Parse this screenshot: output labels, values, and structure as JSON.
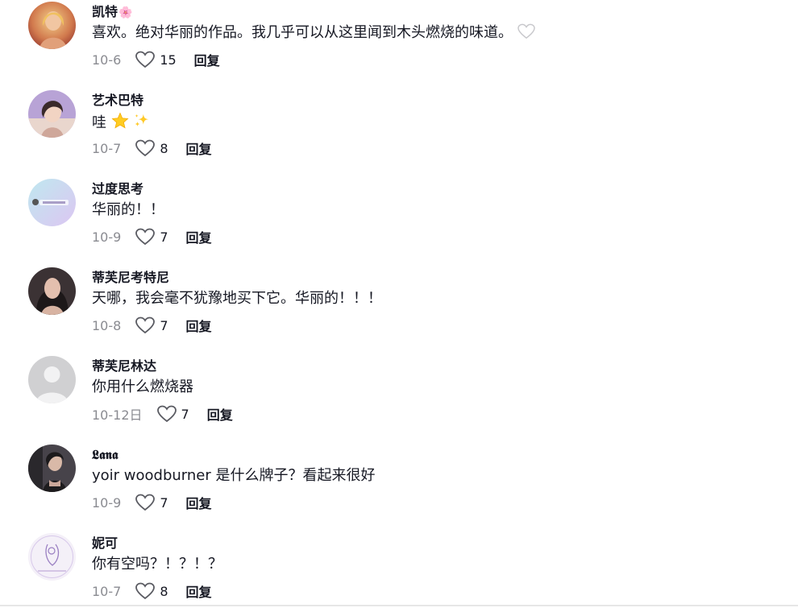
{
  "comments": [
    {
      "username": "凯特",
      "name_emoji": "🌸",
      "text": "喜欢。绝对华丽的作品。我几乎可以从这里闻到木头燃烧的味道。",
      "trailing_icon": "outline-heart-icon",
      "date": "10-6",
      "likes": "15",
      "reply": "回复",
      "avatar_colors": [
        "#c45a48",
        "#e6b15a"
      ]
    },
    {
      "username": "艺术巴特",
      "text": "哇",
      "text_emojis": [
        "star-emoji",
        "sparkles-emoji"
      ],
      "date": "10-7",
      "likes": "8",
      "reply": "回复",
      "avatar_colors": [
        "#8a73b8",
        "#e8d1c5"
      ]
    },
    {
      "username": "过度思考",
      "text": "华丽的！！",
      "date": "10-9",
      "likes": "7",
      "reply": "回复",
      "avatar_colors": [
        "#c6e6ee",
        "#d9c7f0"
      ]
    },
    {
      "username": "蒂芙尼考特尼",
      "text": "天哪，我会毫不犹豫地买下它。华丽的！！！",
      "date": "10-8",
      "likes": "7",
      "reply": "回复",
      "avatar_colors": [
        "#2a2526",
        "#d9b8a6"
      ]
    },
    {
      "username": "蒂芙尼林达",
      "text": "你用什么燃烧器",
      "date": "10-12日",
      "likes": "7",
      "reply": "回复",
      "avatar_colors": [
        "#d5d5d5",
        "#eeeeee"
      ]
    },
    {
      "username": "𝕷𝖆𝖓𝖆",
      "text": "yoir woodburner 是什么牌子？看起来很好",
      "date": "10-9",
      "likes": "7",
      "reply": "回复",
      "avatar_colors": [
        "#2b2b2e",
        "#b7a59a"
      ]
    },
    {
      "username": "妮可",
      "text": "你有空吗？！？！？",
      "date": "10-7",
      "likes": "8",
      "reply": "回复",
      "avatar_colors": [
        "#f1ecf7",
        "#b49ad2"
      ]
    }
  ],
  "colors": {
    "text": "#161823",
    "muted": "#8a8b91",
    "heart_outline": "#8a8b91"
  }
}
